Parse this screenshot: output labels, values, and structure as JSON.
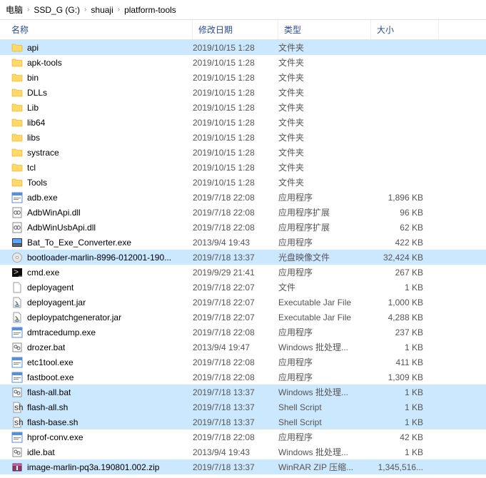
{
  "breadcrumb": {
    "items": [
      "电脑",
      "SSD_G (G:)",
      "shuaji",
      "platform-tools"
    ]
  },
  "columns": {
    "name": "名称",
    "date": "修改日期",
    "type": "类型",
    "size": "大小"
  },
  "files": [
    {
      "icon": "folder",
      "name": "api",
      "date": "2019/10/15 1:28",
      "type": "文件夹",
      "size": "",
      "sel": true
    },
    {
      "icon": "folder",
      "name": "apk-tools",
      "date": "2019/10/15 1:28",
      "type": "文件夹",
      "size": "",
      "sel": false
    },
    {
      "icon": "folder",
      "name": "bin",
      "date": "2019/10/15 1:28",
      "type": "文件夹",
      "size": "",
      "sel": false
    },
    {
      "icon": "folder",
      "name": "DLLs",
      "date": "2019/10/15 1:28",
      "type": "文件夹",
      "size": "",
      "sel": false
    },
    {
      "icon": "folder",
      "name": "Lib",
      "date": "2019/10/15 1:28",
      "type": "文件夹",
      "size": "",
      "sel": false
    },
    {
      "icon": "folder",
      "name": "lib64",
      "date": "2019/10/15 1:28",
      "type": "文件夹",
      "size": "",
      "sel": false
    },
    {
      "icon": "folder",
      "name": "libs",
      "date": "2019/10/15 1:28",
      "type": "文件夹",
      "size": "",
      "sel": false
    },
    {
      "icon": "folder",
      "name": "systrace",
      "date": "2019/10/15 1:28",
      "type": "文件夹",
      "size": "",
      "sel": false
    },
    {
      "icon": "folder",
      "name": "tcl",
      "date": "2019/10/15 1:28",
      "type": "文件夹",
      "size": "",
      "sel": false
    },
    {
      "icon": "folder",
      "name": "Tools",
      "date": "2019/10/15 1:28",
      "type": "文件夹",
      "size": "",
      "sel": false
    },
    {
      "icon": "exe",
      "name": "adb.exe",
      "date": "2019/7/18 22:08",
      "type": "应用程序",
      "size": "1,896 KB",
      "sel": false
    },
    {
      "icon": "dll",
      "name": "AdbWinApi.dll",
      "date": "2019/7/18 22:08",
      "type": "应用程序扩展",
      "size": "96 KB",
      "sel": false
    },
    {
      "icon": "dll",
      "name": "AdbWinUsbApi.dll",
      "date": "2019/7/18 22:08",
      "type": "应用程序扩展",
      "size": "62 KB",
      "sel": false
    },
    {
      "icon": "exe-ico",
      "name": "Bat_To_Exe_Converter.exe",
      "date": "2013/9/4 19:43",
      "type": "应用程序",
      "size": "422 KB",
      "sel": false
    },
    {
      "icon": "iso",
      "name": "bootloader-marlin-8996-012001-190...",
      "date": "2019/7/18 13:37",
      "type": "光盘映像文件",
      "size": "32,424 KB",
      "sel": true
    },
    {
      "icon": "cmd",
      "name": "cmd.exe",
      "date": "2019/9/29 21:41",
      "type": "应用程序",
      "size": "267 KB",
      "sel": false
    },
    {
      "icon": "file",
      "name": "deployagent",
      "date": "2019/7/18 22:07",
      "type": "文件",
      "size": "1 KB",
      "sel": false
    },
    {
      "icon": "jar",
      "name": "deployagent.jar",
      "date": "2019/7/18 22:07",
      "type": "Executable Jar File",
      "size": "1,000 KB",
      "sel": false
    },
    {
      "icon": "jar",
      "name": "deploypatchgenerator.jar",
      "date": "2019/7/18 22:07",
      "type": "Executable Jar File",
      "size": "4,288 KB",
      "sel": false
    },
    {
      "icon": "exe",
      "name": "dmtracedump.exe",
      "date": "2019/7/18 22:08",
      "type": "应用程序",
      "size": "237 KB",
      "sel": false
    },
    {
      "icon": "bat",
      "name": "drozer.bat",
      "date": "2013/9/4 19:47",
      "type": "Windows 批处理...",
      "size": "1 KB",
      "sel": false
    },
    {
      "icon": "exe",
      "name": "etc1tool.exe",
      "date": "2019/7/18 22:08",
      "type": "应用程序",
      "size": "411 KB",
      "sel": false
    },
    {
      "icon": "exe",
      "name": "fastboot.exe",
      "date": "2019/7/18 22:08",
      "type": "应用程序",
      "size": "1,309 KB",
      "sel": false
    },
    {
      "icon": "bat",
      "name": "flash-all.bat",
      "date": "2019/7/18 13:37",
      "type": "Windows 批处理...",
      "size": "1 KB",
      "sel": true
    },
    {
      "icon": "sh",
      "name": "flash-all.sh",
      "date": "2019/7/18 13:37",
      "type": "Shell Script",
      "size": "1 KB",
      "sel": true
    },
    {
      "icon": "sh",
      "name": "flash-base.sh",
      "date": "2019/7/18 13:37",
      "type": "Shell Script",
      "size": "1 KB",
      "sel": true
    },
    {
      "icon": "exe",
      "name": "hprof-conv.exe",
      "date": "2019/7/18 22:08",
      "type": "应用程序",
      "size": "42 KB",
      "sel": false
    },
    {
      "icon": "bat",
      "name": "idle.bat",
      "date": "2013/9/4 19:43",
      "type": "Windows 批处理...",
      "size": "1 KB",
      "sel": false
    },
    {
      "icon": "zip",
      "name": "image-marlin-pq3a.190801.002.zip",
      "date": "2019/7/18 13:37",
      "type": "WinRAR ZIP 压缩...",
      "size": "1,345,516...",
      "sel": true
    }
  ]
}
